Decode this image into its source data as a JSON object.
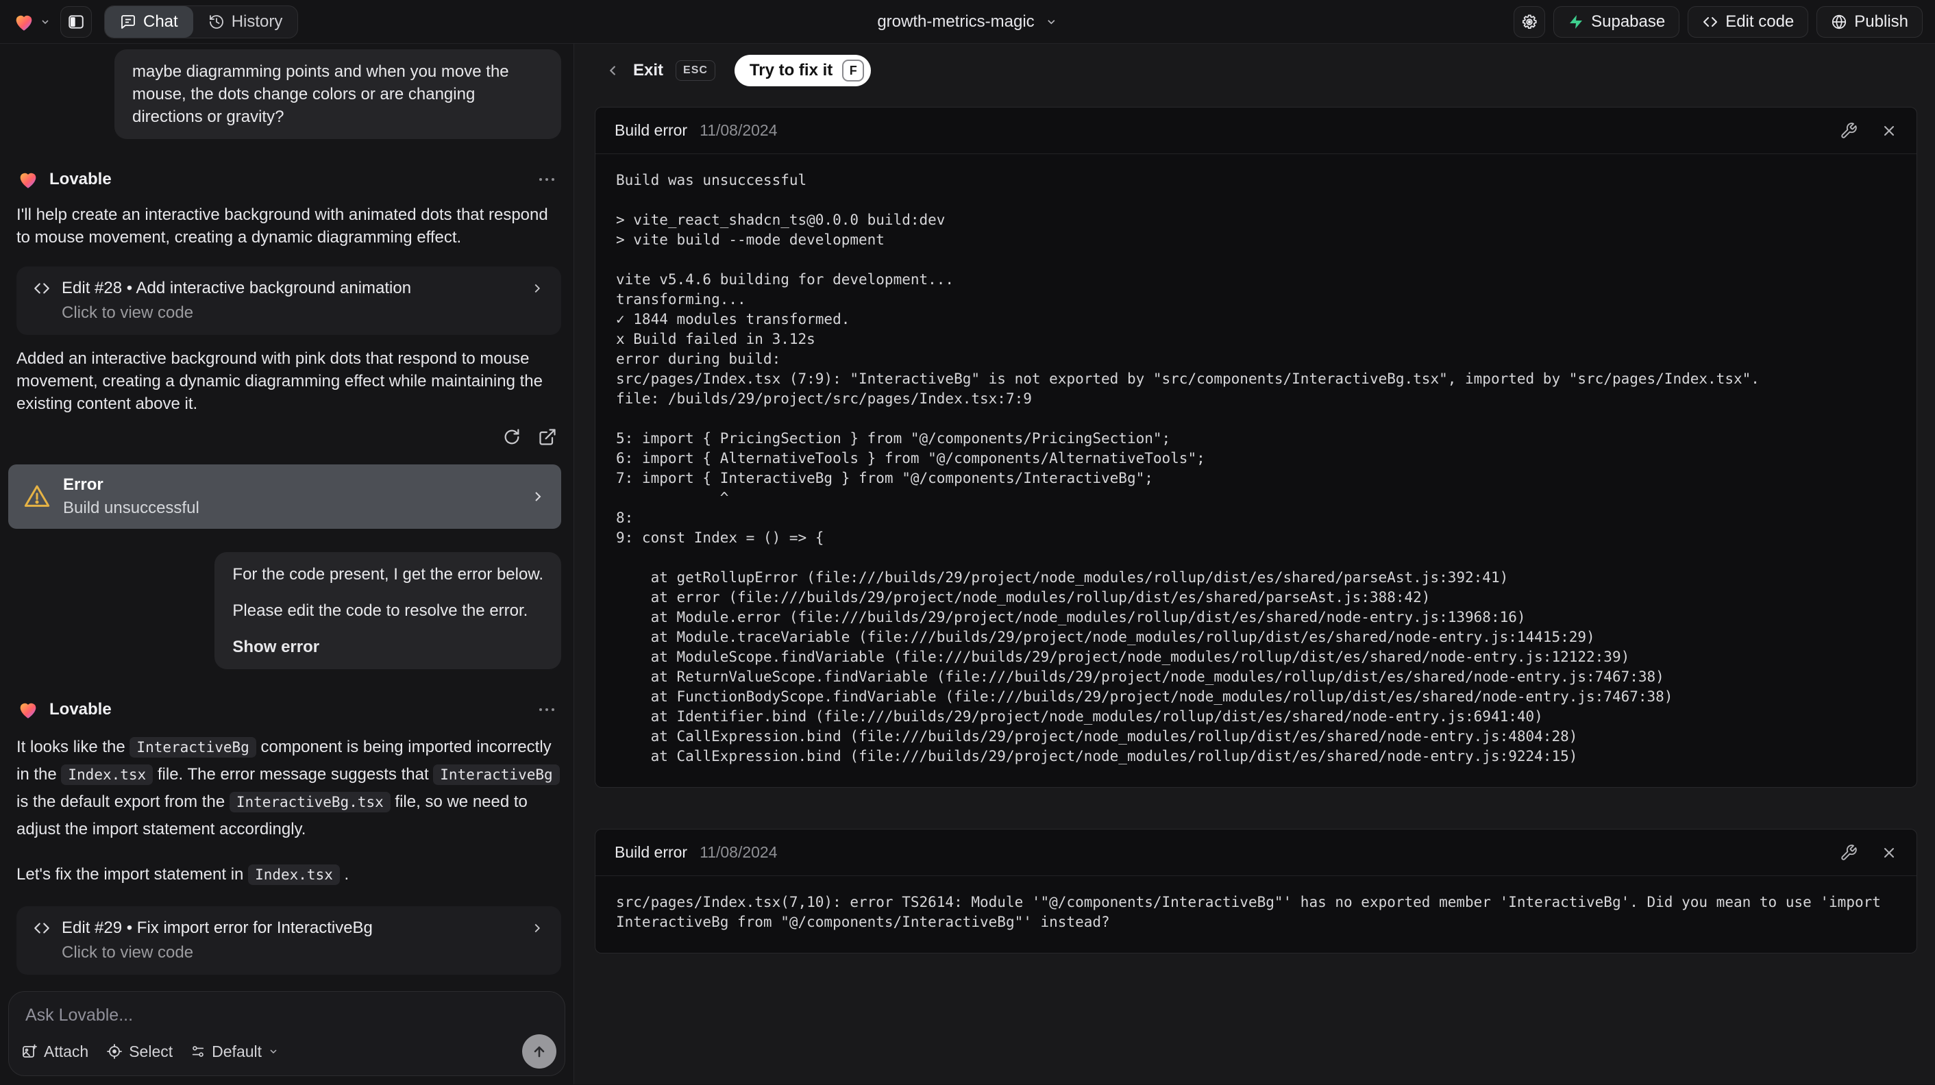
{
  "colors": {
    "accent-green": "#3ecf8e",
    "warning": "#e6b345",
    "user-bubble": "#252528",
    "selected-error": "#4c4f55"
  },
  "topbar": {
    "project_name": "growth-metrics-magic",
    "tab_chat": "Chat",
    "tab_history": "History",
    "supabase": "Supabase",
    "edit_code": "Edit code",
    "publish": "Publish"
  },
  "chat": {
    "assistant_name": "Lovable",
    "assistant_name_2": "Lovable",
    "user1": "maybe diagramming points and when you move the mouse, the dots change colors or are changing directions or gravity?",
    "a1p1": "I'll help create an interactive background with animated dots that respond to mouse movement, creating a dynamic diagramming effect.",
    "edit28_title": "Edit #28 • Add interactive background animation",
    "edit28_sub": "Click to view code",
    "a1p2": "Added an interactive background with pink dots that respond to mouse movement, creating a dynamic diagramming effect while maintaining the existing content above it.",
    "error_title": "Error",
    "error_sub": "Build unsuccessful",
    "user2_l1": "For the code present, I get the error below.",
    "user2_l2": "Please edit the code to resolve the error.",
    "user2_action": "Show error",
    "assistant2": {
      "p1": [
        "It looks like the ",
        "InteractiveBg",
        " component is being imported incorrectly in the ",
        "Index.tsx",
        " file. The error message suggests that ",
        "InteractiveBg",
        " is the default export from the ",
        "InteractiveBg.tsx",
        " file, so we need to adjust the import statement accordingly."
      ],
      "p2": [
        "Let's fix the import statement in ",
        "Index.tsx",
        " ."
      ]
    },
    "edit29_title": "Edit #29 • Fix import error for InteractiveBg",
    "edit29_sub": "Click to view code",
    "input_placeholder": "Ask Lovable...",
    "attach": "Attach",
    "select": "Select",
    "mode": "Default"
  },
  "preview": {
    "exit": "Exit",
    "esc_key": "ESC",
    "fix_label": "Try to fix it",
    "fix_key": "F",
    "card1": {
      "title": "Build error",
      "date": "11/08/2024",
      "log": "Build was unsuccessful\n\n> vite_react_shadcn_ts@0.0.0 build:dev\n> vite build --mode development\n\nvite v5.4.6 building for development...\ntransforming...\n✓ 1844 modules transformed.\nx Build failed in 3.12s\nerror during build:\nsrc/pages/Index.tsx (7:9): \"InteractiveBg\" is not exported by \"src/components/InteractiveBg.tsx\", imported by \"src/pages/Index.tsx\".\nfile: /builds/29/project/src/pages/Index.tsx:7:9\n\n5: import { PricingSection } from \"@/components/PricingSection\";\n6: import { AlternativeTools } from \"@/components/AlternativeTools\";\n7: import { InteractiveBg } from \"@/components/InteractiveBg\";\n            ^\n8: \n9: const Index = () => {\n\n    at getRollupError (file:///builds/29/project/node_modules/rollup/dist/es/shared/parseAst.js:392:41)\n    at error (file:///builds/29/project/node_modules/rollup/dist/es/shared/parseAst.js:388:42)\n    at Module.error (file:///builds/29/project/node_modules/rollup/dist/es/shared/node-entry.js:13968:16)\n    at Module.traceVariable (file:///builds/29/project/node_modules/rollup/dist/es/shared/node-entry.js:14415:29)\n    at ModuleScope.findVariable (file:///builds/29/project/node_modules/rollup/dist/es/shared/node-entry.js:12122:39)\n    at ReturnValueScope.findVariable (file:///builds/29/project/node_modules/rollup/dist/es/shared/node-entry.js:7467:38)\n    at FunctionBodyScope.findVariable (file:///builds/29/project/node_modules/rollup/dist/es/shared/node-entry.js:7467:38)\n    at Identifier.bind (file:///builds/29/project/node_modules/rollup/dist/es/shared/node-entry.js:6941:40)\n    at CallExpression.bind (file:///builds/29/project/node_modules/rollup/dist/es/shared/node-entry.js:4804:28)\n    at CallExpression.bind (file:///builds/29/project/node_modules/rollup/dist/es/shared/node-entry.js:9224:15)"
    },
    "card2": {
      "title": "Build error",
      "date": "11/08/2024",
      "log": "src/pages/Index.tsx(7,10): error TS2614: Module '\"@/components/InteractiveBg\"' has no exported member 'InteractiveBg'. Did you mean to use 'import InteractiveBg from \"@/components/InteractiveBg\"' instead?"
    }
  }
}
